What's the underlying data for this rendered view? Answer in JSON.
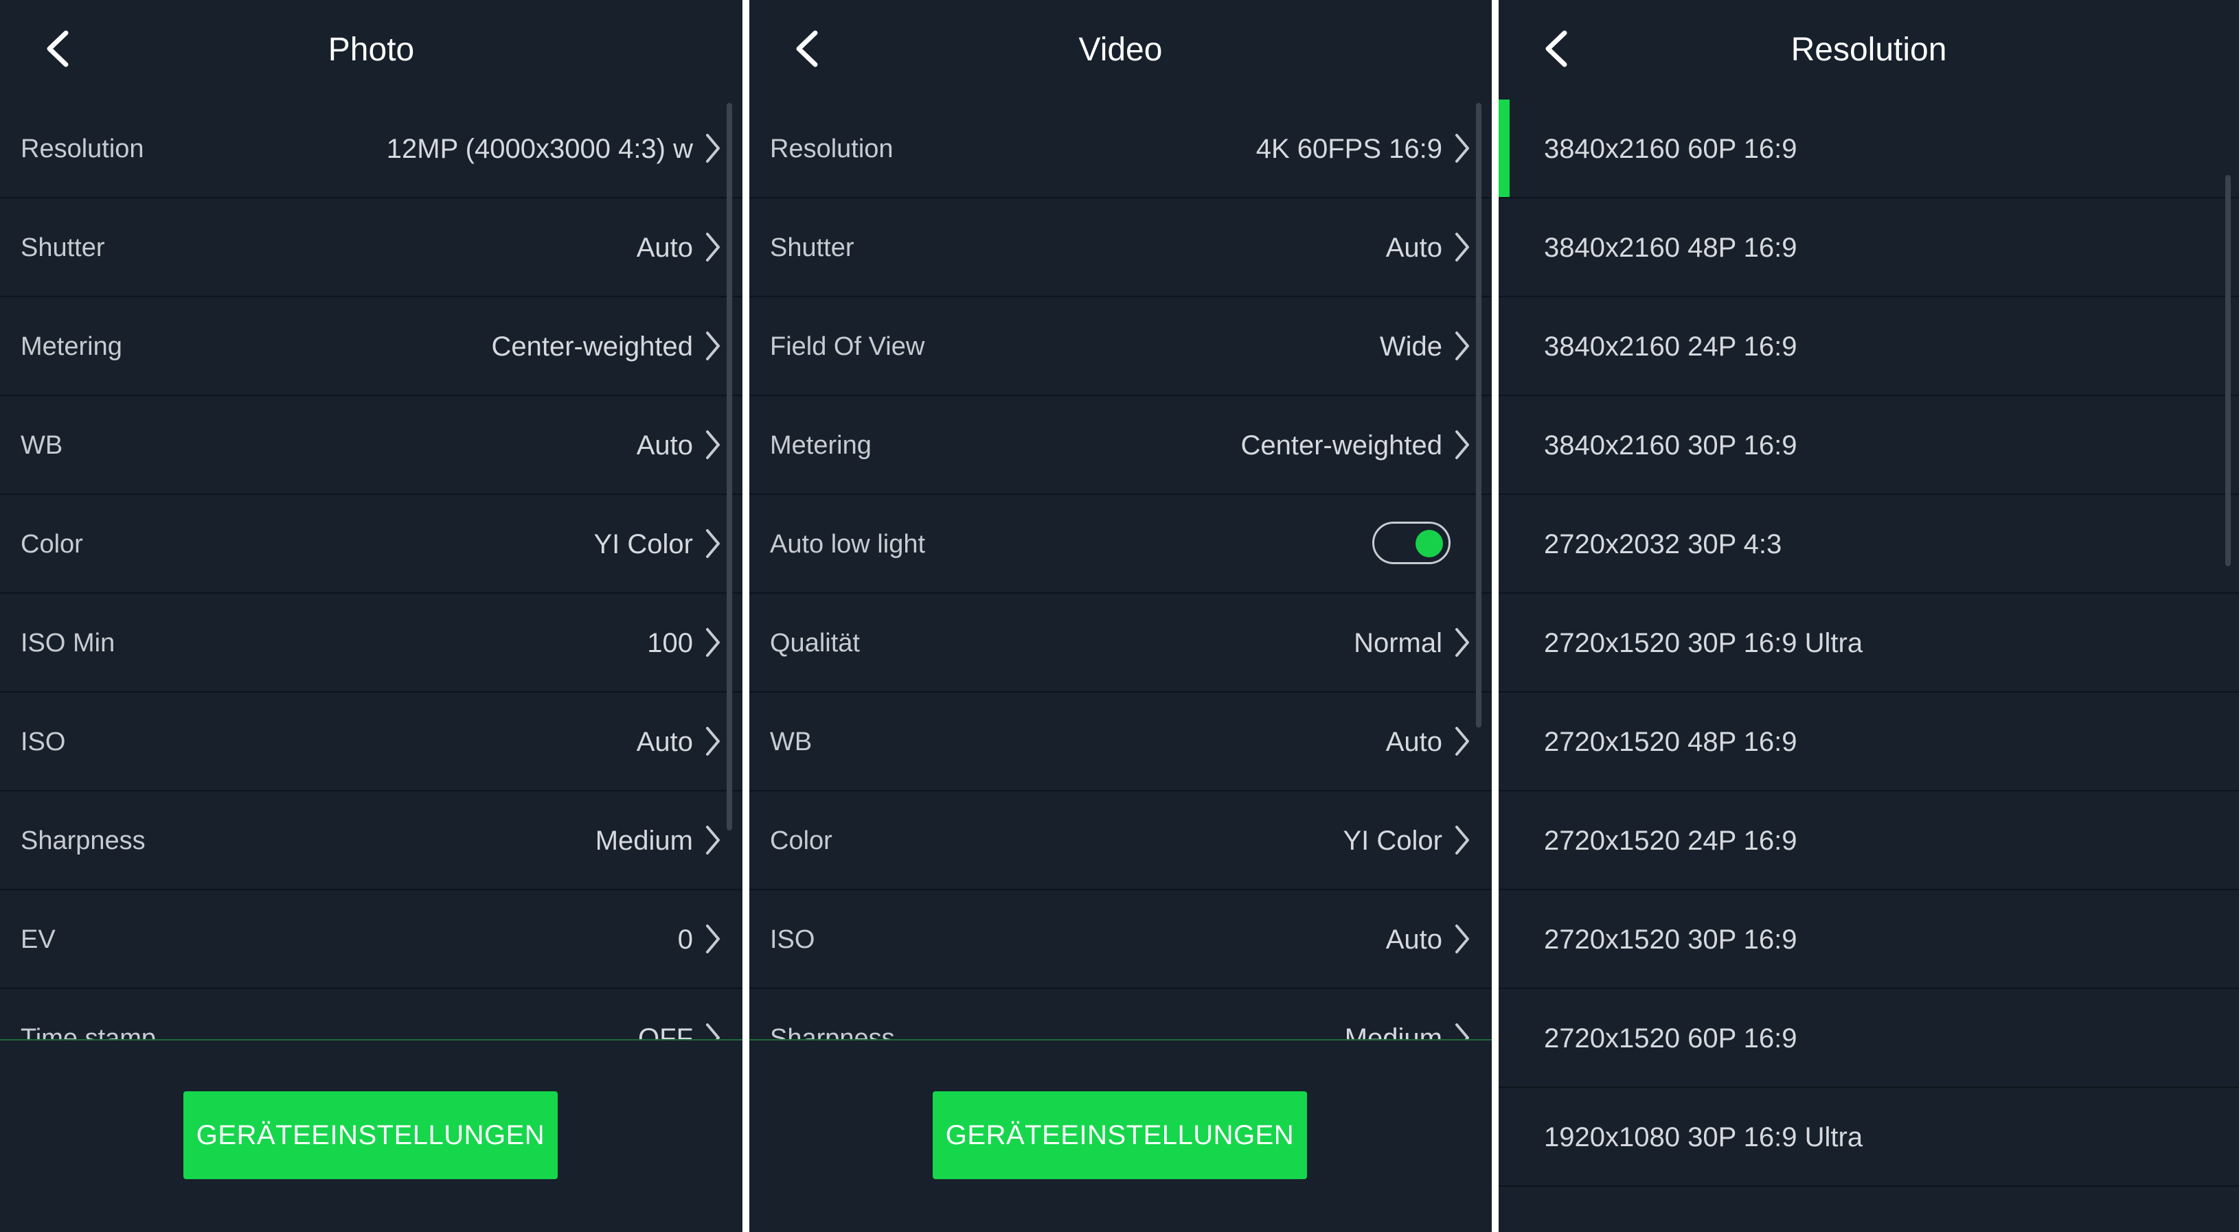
{
  "photo": {
    "title": "Photo",
    "rows": [
      {
        "label": "Resolution",
        "value": "12MP (4000x3000 4:3) w"
      },
      {
        "label": "Shutter",
        "value": "Auto"
      },
      {
        "label": "Metering",
        "value": "Center-weighted"
      },
      {
        "label": "WB",
        "value": "Auto"
      },
      {
        "label": "Color",
        "value": "YI Color"
      },
      {
        "label": "ISO Min",
        "value": "100"
      },
      {
        "label": "ISO",
        "value": "Auto"
      },
      {
        "label": "Sharpness",
        "value": "Medium"
      },
      {
        "label": "EV",
        "value": "0"
      },
      {
        "label": "Time stamp",
        "value": "OFF"
      }
    ],
    "button": "GERÄTEEINSTELLUNGEN"
  },
  "video": {
    "title": "Video",
    "rows": [
      {
        "label": "Resolution",
        "value": "4K 60FPS 16:9"
      },
      {
        "label": "Shutter",
        "value": "Auto"
      },
      {
        "label": "Field Of View",
        "value": "Wide"
      },
      {
        "label": "Metering",
        "value": "Center-weighted"
      },
      {
        "label": "Auto low light",
        "toggle": true
      },
      {
        "label": "Qualität",
        "value": "Normal"
      },
      {
        "label": "WB",
        "value": "Auto"
      },
      {
        "label": "Color",
        "value": "YI Color"
      },
      {
        "label": "ISO",
        "value": "Auto"
      },
      {
        "label": "Sharpness",
        "value": "Medium"
      }
    ],
    "button": "GERÄTEEINSTELLUNGEN"
  },
  "resolution": {
    "title": "Resolution",
    "selected_index": 0,
    "options": [
      "3840x2160 60P 16:9",
      "3840x2160 48P 16:9",
      "3840x2160 24P 16:9",
      "3840x2160 30P 16:9",
      "2720x2032 30P 4:3",
      "2720x1520 30P 16:9 Ultra",
      "2720x1520 48P 16:9",
      "2720x1520 24P 16:9",
      "2720x1520 30P 16:9",
      "2720x1520 60P 16:9",
      "1920x1080 30P 16:9 Ultra"
    ]
  },
  "icons": {
    "back": "chevron-left-icon",
    "row_arrow": "chevron-right-icon"
  },
  "colors": {
    "background": "#17202b",
    "accent": "#16d64c",
    "divider": "#0d141c"
  }
}
